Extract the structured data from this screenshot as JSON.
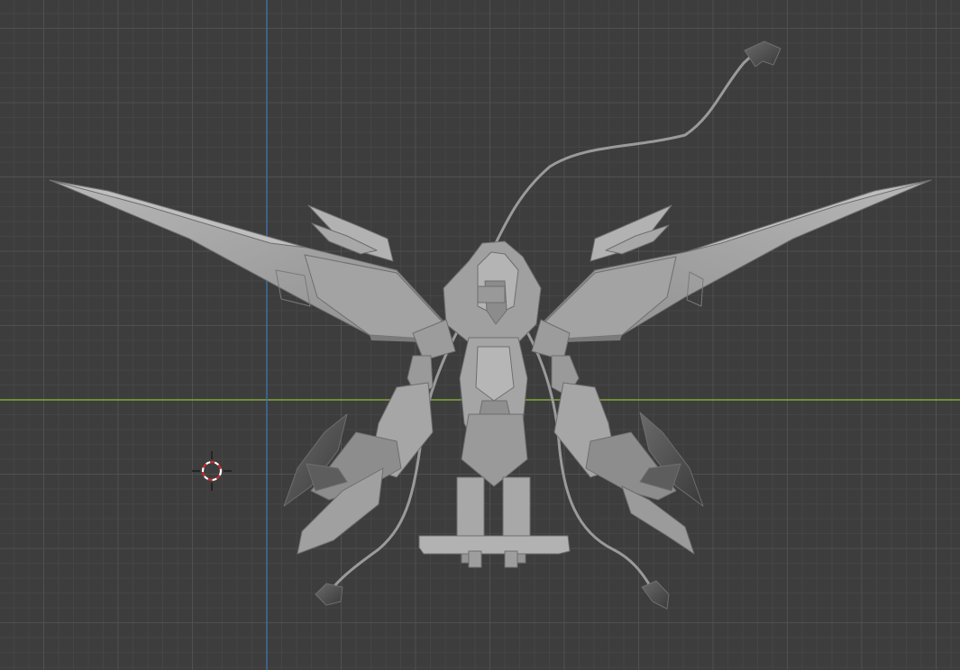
{
  "viewport": {
    "background_color": "#3d3d3d",
    "grid": "on",
    "grid_minor_color": "#454545",
    "grid_major_color": "#505050",
    "x_axis_color": "#7ea83a",
    "y_axis_color": "#3f6fa8",
    "shading": "solid",
    "object_color": "#a6a6a6",
    "object_edge_color": "#6e6e6e",
    "object_dark_color": "#4a4a4a"
  },
  "scene": {
    "model": "winged-mecha-model",
    "cursor_icon": "3d-cursor-icon"
  }
}
